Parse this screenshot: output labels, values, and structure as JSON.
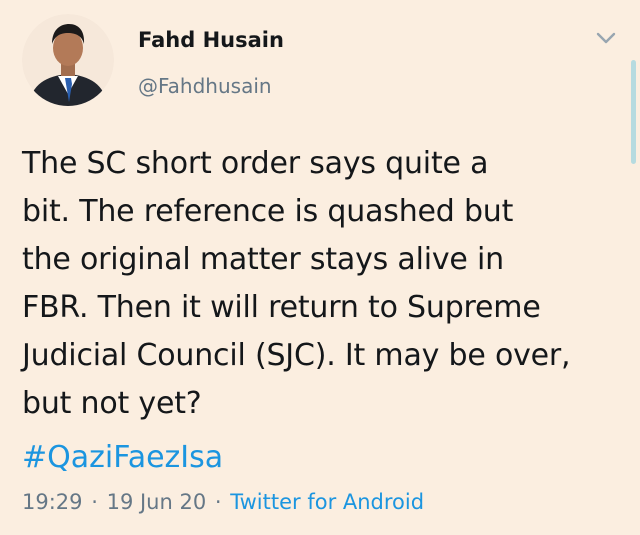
{
  "author": {
    "display_name": "Fahd Husain",
    "handle": "@Fahdhusain"
  },
  "tweet": {
    "lines": [
      "The SC short order says quite a",
      "bit. The reference is quashed but",
      "the original matter stays alive in",
      "FBR. Then it will return to Supreme",
      "Judicial Council (SJC). It may be over,",
      "but not yet?"
    ],
    "hashtag": "#QaziFaezIsa"
  },
  "meta": {
    "time": "19:29",
    "separator": "·",
    "date": "19 Jun 20",
    "source": "Twitter for Android"
  },
  "icons": {
    "caret": "chevron-down-icon"
  },
  "colors": {
    "background": "#fbeee0",
    "text": "#14171a",
    "secondary": "#657786",
    "link": "#1b95e0"
  }
}
